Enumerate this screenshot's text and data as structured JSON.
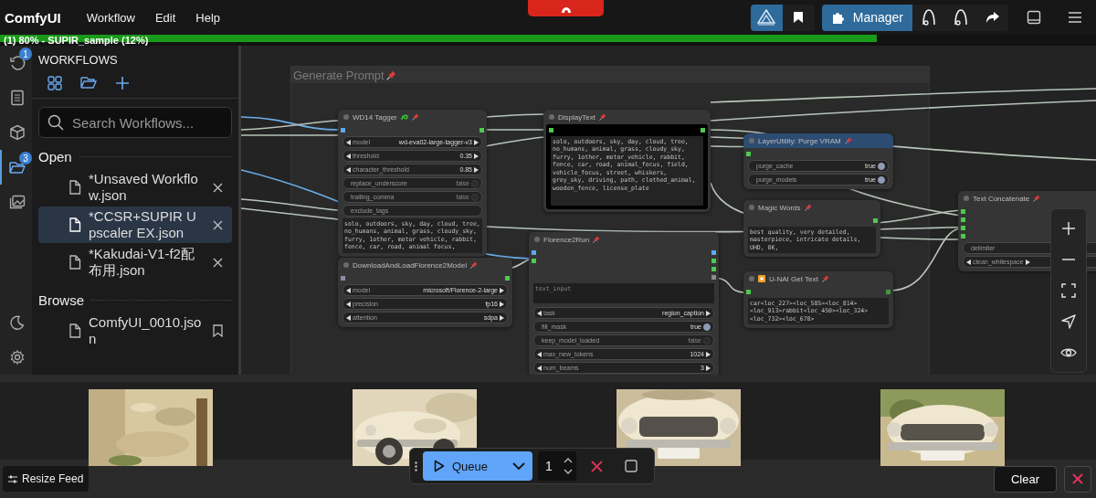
{
  "app": {
    "title": "ComfyUI",
    "menu": [
      "Workflow",
      "Edit",
      "Help"
    ]
  },
  "toolbar": {
    "groups": [
      [
        {
          "kind": "logo",
          "selected": true
        },
        {
          "kind": "bookmark",
          "selected": false
        }
      ],
      [
        {
          "kind": "manager",
          "label": "Manager",
          "selected": true
        },
        {
          "kind": "arch",
          "selected": false
        },
        {
          "kind": "arch",
          "selected": false
        },
        {
          "kind": "share",
          "selected": false
        }
      ]
    ]
  },
  "progress": {
    "text": "(1) 80% - SUPIR_sample (12%)",
    "level": 0.8
  },
  "rail": {
    "items": [
      {
        "kind": "queue",
        "badge": "1",
        "selected": false
      },
      {
        "kind": "library",
        "selected": false
      },
      {
        "kind": "models",
        "selected": false
      },
      {
        "kind": "workflows",
        "badge": "3",
        "selected": true
      },
      {
        "kind": "images",
        "selected": false
      }
    ],
    "bottom": [
      {
        "kind": "theme"
      },
      {
        "kind": "settings"
      }
    ]
  },
  "sidebar": {
    "title": "WORKFLOWS",
    "search": {
      "placeholder": "Search Workflows..."
    },
    "sections": [
      {
        "title": "Open",
        "items": [
          {
            "name": "*Unsaved Workflow.json",
            "selected": false
          },
          {
            "name": "*CCSR+SUPIR Upscaler EX.json",
            "selected": true
          },
          {
            "name": "*Kakudai-V1-f2配布用.json",
            "selected": false
          }
        ]
      },
      {
        "title": "Browse",
        "items": [
          {
            "name": "ComfyUI_0010.json",
            "selected": false
          }
        ]
      }
    ]
  },
  "canvas": {
    "group": {
      "title": "Generate Prompt"
    },
    "nodes": [
      {
        "title": "WD14 Tagger",
        "color": "#353535",
        "inputs": [
          {
            "color": "#5fa8e8"
          }
        ],
        "outputs": [
          {
            "color": "#4fc94f"
          }
        ],
        "widgets": [
          {
            "kind": "combo",
            "label": "model",
            "value": "wd-eva02-large-tagger-v3"
          },
          {
            "kind": "combo",
            "label": "threshold",
            "value": "0.35"
          },
          {
            "kind": "combo",
            "label": "character_threshold",
            "value": "0.85"
          },
          {
            "kind": "toggle",
            "label": "replace_underscore",
            "value": "false",
            "on": false
          },
          {
            "kind": "toggle",
            "label": "trailing_comma",
            "value": "false",
            "on": false
          },
          {
            "kind": "field",
            "label": "exclude_tags"
          },
          {
            "kind": "text",
            "value": "solo, outdoors, sky, day, cloud, tree, no_humans, animal, grass, cloudy_sky, furry, 1other, motor vehicle, rabbit, fence, car, road, animal focus,"
          }
        ]
      },
      {
        "title": "DisplayText",
        "color": "#353535",
        "inputs": [
          {
            "color": "#4fc94f"
          }
        ],
        "outputs": [
          {
            "color": "#4fc94f"
          }
        ],
        "widgets": [
          {
            "kind": "display",
            "value": "solo, outdoors, sky, day, cloud, tree, no_humans, animal, grass, cloudy_sky, furry, 1other, motor_vehicle, rabbit, fence, car, road, animal_focus, field, vehicle_focus, street, whiskers, grey_sky, driving, path, clothed_animal, wooden_fence, license_plate"
          }
        ]
      },
      {
        "title": "LayerUtility: Purge VRAM",
        "color": "#2c4c72",
        "inputs": [
          {
            "color": "#4fc94f"
          }
        ],
        "widgets": [
          {
            "kind": "toggle",
            "label": "purge_cache",
            "value": "true",
            "on": true
          },
          {
            "kind": "toggle",
            "label": "purge_models",
            "value": "true",
            "on": true
          }
        ]
      },
      {
        "title": "Magic Words",
        "color": "#353535",
        "outputs": [
          {
            "color": "#4fc94f"
          }
        ],
        "widgets": [
          {
            "kind": "text",
            "value": "best quality, very detailed, masterpiece, intricate details, UHD, 8K,"
          }
        ]
      },
      {
        "title": "Text Concatenate",
        "color": "#353535",
        "inputs": [
          {
            "color": "#4fc94f"
          },
          {
            "color": "#4fc94f"
          },
          {
            "color": "#4fc94f"
          },
          {
            "color": "#4fc94f"
          }
        ],
        "widgets": [
          {
            "kind": "field",
            "label": "delimiter"
          },
          {
            "kind": "combo",
            "label": "clean_whitespace"
          }
        ]
      },
      {
        "title": "DownloadAndLoadFlorence2Model",
        "color": "#353535",
        "inputs": [
          {
            "color": "#8a8aa8"
          }
        ],
        "outputs": [
          {
            "color": "#4fc94f"
          }
        ],
        "widgets": [
          {
            "kind": "combo",
            "label": "model",
            "value": "microsoft/Florence-2-large"
          },
          {
            "kind": "combo",
            "label": "precision",
            "value": "fp16"
          },
          {
            "kind": "combo",
            "label": "attention",
            "value": "sdpa"
          }
        ]
      },
      {
        "title": "Florence2Run",
        "color": "#353535",
        "inputs": [
          {
            "color": "#5fa8e8"
          },
          {
            "color": "#4fc94f"
          }
        ],
        "outputs": [
          {
            "color": "#5fa8e8"
          },
          {
            "color": "#4fc94f"
          },
          {
            "color": "#4fc94f"
          },
          {
            "color": "#8a8a8a"
          }
        ],
        "widgets": [
          {
            "kind": "input",
            "placeholder": "text_input"
          },
          {
            "kind": "combo",
            "label": "task",
            "value": "region_caption"
          },
          {
            "kind": "toggle",
            "label": "fill_mask",
            "value": "true",
            "on": true
          },
          {
            "kind": "toggle",
            "label": "keep_model_loaded",
            "value": "false",
            "on": false
          },
          {
            "kind": "combo",
            "label": "max_new_tokens",
            "value": "1024"
          },
          {
            "kind": "combo",
            "label": "num_beams",
            "value": "3"
          }
        ]
      },
      {
        "title": "U-NAI Get Text",
        "color": "#353535",
        "inputs": [
          {
            "color": "#4fc94f"
          }
        ],
        "outputs": [
          {
            "color": "#3f9a3f"
          }
        ],
        "widgets": [
          {
            "kind": "text",
            "value": "car<loc_227><loc_585><loc_814><loc_913>rabbit<loc_450><loc_324><loc_732><loc_678>"
          }
        ]
      }
    ]
  },
  "feed": {
    "resize_label": "Resize Feed",
    "clear_label": "Clear"
  },
  "queue": {
    "label": "Queue",
    "count": "1"
  }
}
